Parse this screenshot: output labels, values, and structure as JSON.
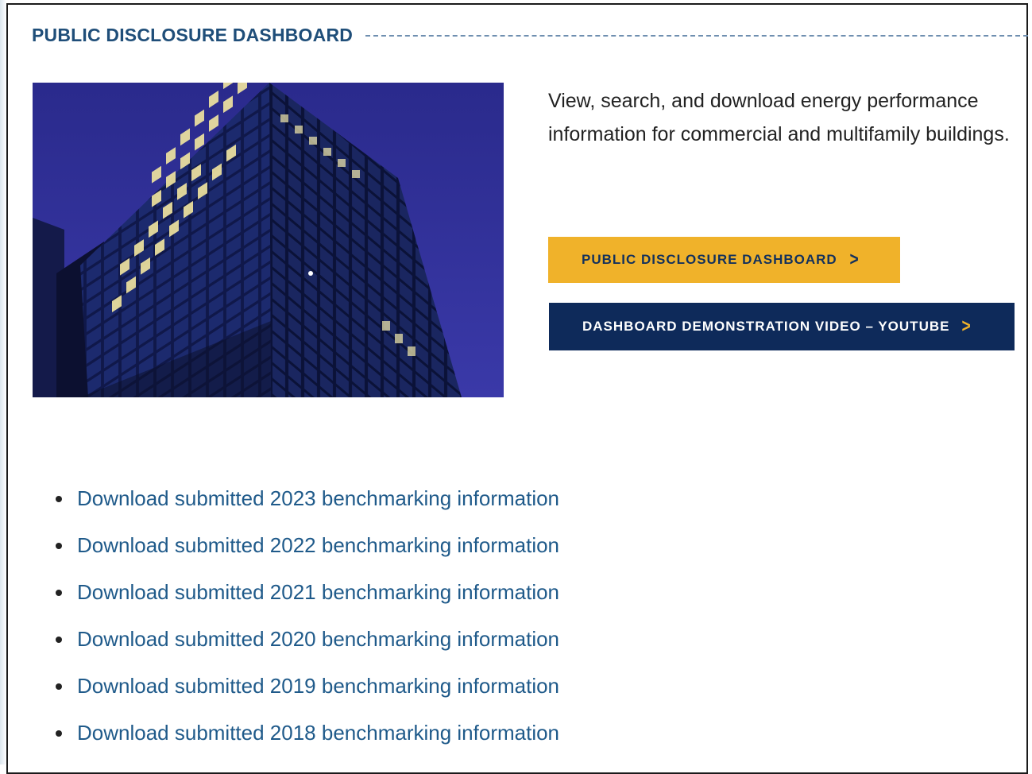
{
  "section": {
    "title": "PUBLIC DISCLOSURE DASHBOARD"
  },
  "intro": {
    "description": "View, search, and download energy performance information for commercial and multifamily buildings."
  },
  "buttons": {
    "dashboard_label": "PUBLIC DISCLOSURE DASHBOARD",
    "video_label": "DASHBOARD DEMONSTRATION VIDEO – YOUTUBE"
  },
  "downloads": [
    {
      "label": "Download submitted 2023 benchmarking information"
    },
    {
      "label": "Download submitted 2022 benchmarking information"
    },
    {
      "label": "Download submitted 2021 benchmarking information"
    },
    {
      "label": "Download submitted 2020 benchmarking information"
    },
    {
      "label": "Download submitted 2019 benchmarking information"
    },
    {
      "label": "Download submitted 2018 benchmarking information"
    }
  ],
  "icons": {
    "button_chevron": "chevron-right-icon"
  },
  "colors": {
    "title": "#1f4e79",
    "gold_button": "#f0b22a",
    "navy_button": "#0e2a5a",
    "link": "#1f5a8a"
  }
}
